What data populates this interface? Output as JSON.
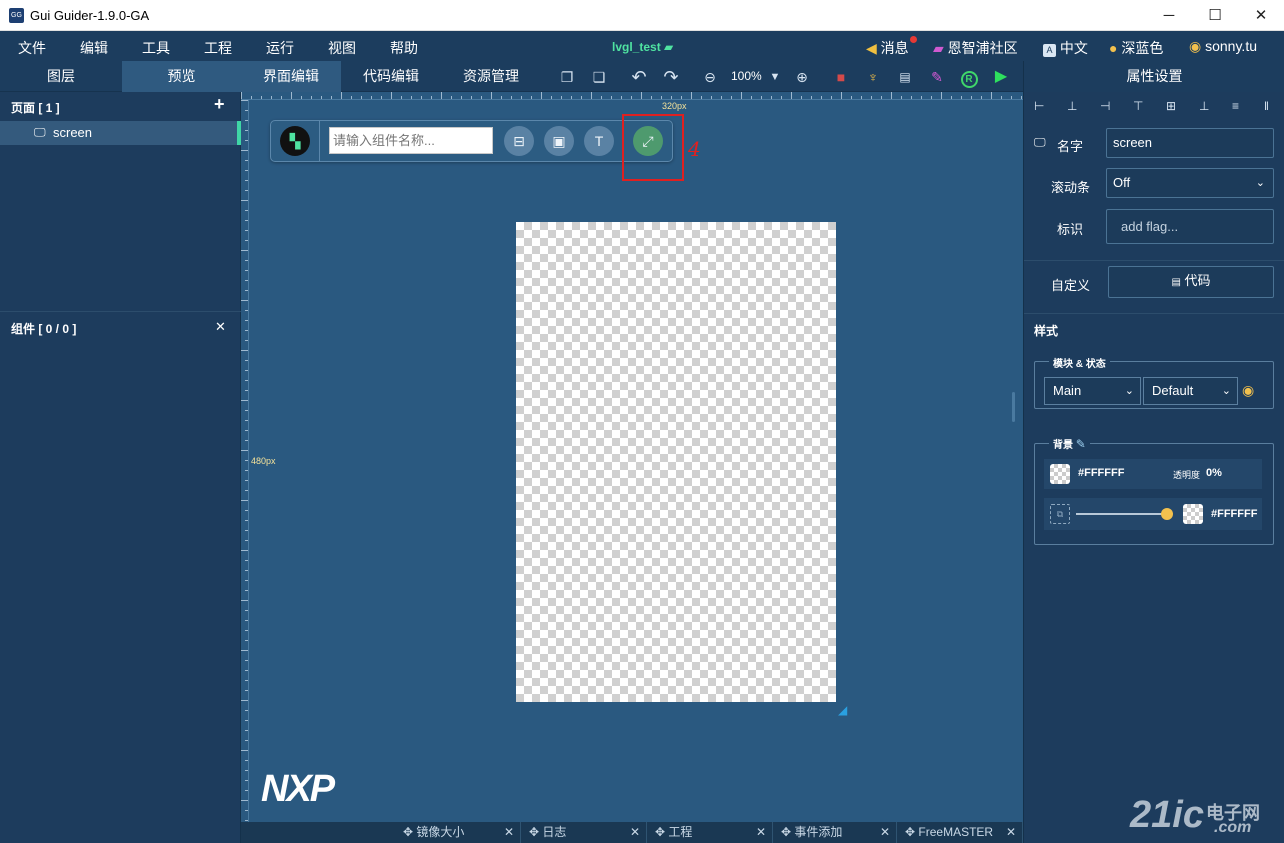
{
  "window": {
    "title": "Gui Guider-1.9.0-GA",
    "minimize": "─",
    "maximize": "☐",
    "close": "✕",
    "app_icon_text": "GG"
  },
  "menu": {
    "items": [
      "文件",
      "编辑",
      "工具",
      "工程",
      "运行",
      "视图",
      "帮助"
    ],
    "project_name": "lvgl_test",
    "right": {
      "messages": "消息",
      "community": "恩智浦社区",
      "language": "中文",
      "theme": "深蓝色",
      "user": "sonny.tu"
    }
  },
  "left_tabs": {
    "layers": "图层",
    "preview": "预览"
  },
  "center_tabs": {
    "ui_edit": "界面编辑",
    "code_edit": "代码编辑",
    "resource_mgmt": "资源管理"
  },
  "toolbar": {
    "zoom": "100%"
  },
  "right_title": "属性设置",
  "pages": {
    "title": "页面 [ 1 ]",
    "add": "+",
    "items": [
      {
        "label": "screen"
      }
    ]
  },
  "widgets": {
    "title": "组件 [ 0 / 0 ]"
  },
  "canvas": {
    "ruler_width_label": "320px",
    "ruler_height_label": "480px",
    "search_placeholder": "请输入组件名称...",
    "annotation": "4",
    "logo": "NXP"
  },
  "bottom_tabs": [
    "镜像大小",
    "日志",
    "工程",
    "事件添加",
    "FreeMASTER"
  ],
  "properties": {
    "name_label": "名字",
    "name_value": "screen",
    "scrollbar_label": "滚动条",
    "scrollbar_value": "Off",
    "flag_label": "标识",
    "flag_placeholder": "add flag...",
    "custom_label": "自定义",
    "code_button": "代码",
    "style_title": "样式",
    "part_state_legend": "模块 & 状态",
    "part_value": "Main",
    "state_value": "Default",
    "background_legend": "背景",
    "bg_color": "#FFFFFF",
    "opacity_label": "透明度",
    "opacity_value": "0%",
    "gradient_color": "#FFFFFF"
  },
  "watermark": {
    "brand": "21ic",
    "sub": "电子网",
    "domain": ".com"
  }
}
